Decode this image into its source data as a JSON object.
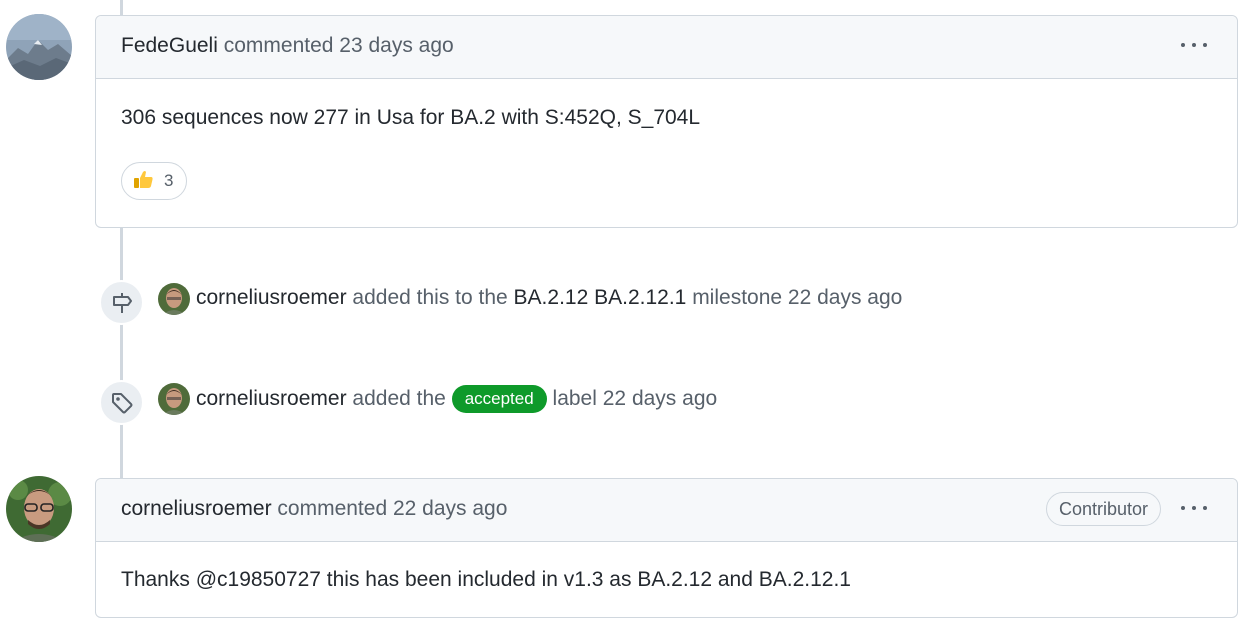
{
  "comment1": {
    "author": "FedeGueli",
    "action": "commented",
    "time": "23 days ago",
    "body": "306 sequences now 277 in Usa for BA.2 with S:452Q, S_704L",
    "reaction": {
      "emoji": "thumbs-up",
      "count": "3"
    }
  },
  "event1": {
    "actor": "corneliusroemer",
    "text_before": "added this to the",
    "milestone": "BA.2.12 BA.2.12.1",
    "text_after": "milestone",
    "time": "22 days ago",
    "icon": "milestone-icon"
  },
  "event2": {
    "actor": "corneliusroemer",
    "text_before": "added the",
    "label": "accepted",
    "label_color": "#0e9a2a",
    "text_after": "label",
    "time": "22 days ago",
    "icon": "tag-icon"
  },
  "comment2": {
    "author": "corneliusroemer",
    "action": "commented",
    "time": "22 days ago",
    "badge": "Contributor",
    "body": "Thanks @c19850727 this has been included in v1.3 as BA.2.12 and BA.2.12.1"
  }
}
